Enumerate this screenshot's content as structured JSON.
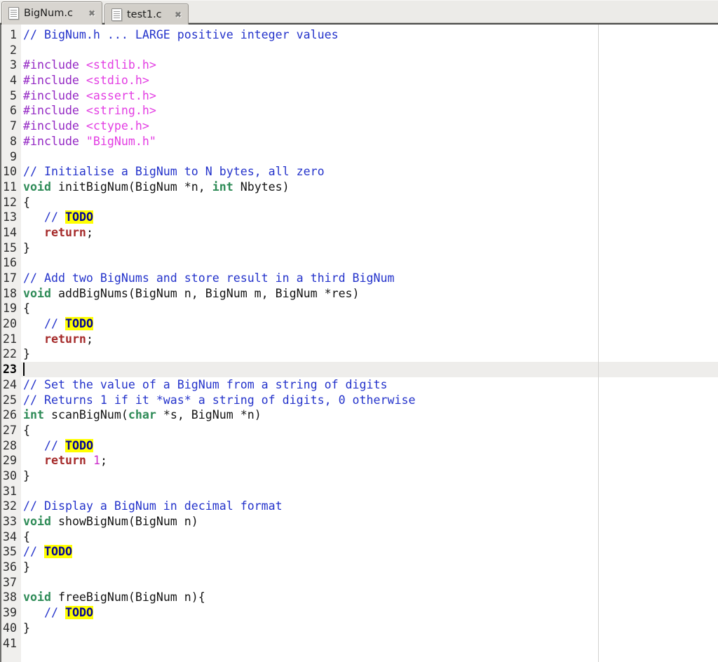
{
  "tabs": [
    {
      "label": "BigNum.c",
      "active": true
    },
    {
      "label": "test1.c",
      "active": false
    }
  ],
  "icons": {
    "close": "✖",
    "document": "document-icon"
  },
  "colors": {
    "comment": "#2433cb",
    "preprocessor": "#9428c4",
    "include_string": "#e33ee3",
    "type_keyword": "#2e8b57",
    "flow_keyword": "#a52a2a",
    "number": "#cb2dcb",
    "todo_fg": "#000099",
    "todo_bg": "#ffff00",
    "current_line_bg": "#eeedeb",
    "margin_line": "#d2d1cf",
    "gutter_bg": "#f0efed",
    "tabbar_bg": "#ecebe8"
  },
  "editor": {
    "current_line": 23,
    "lines": [
      {
        "n": 1,
        "segs": [
          [
            "comment",
            "// BigNum.h ... LARGE positive integer values"
          ]
        ]
      },
      {
        "n": 2,
        "segs": []
      },
      {
        "n": 3,
        "segs": [
          [
            "preproc",
            "#include "
          ],
          [
            "incstr",
            "<stdlib.h>"
          ]
        ]
      },
      {
        "n": 4,
        "segs": [
          [
            "preproc",
            "#include "
          ],
          [
            "incstr",
            "<stdio.h>"
          ]
        ]
      },
      {
        "n": 5,
        "segs": [
          [
            "preproc",
            "#include "
          ],
          [
            "incstr",
            "<assert.h>"
          ]
        ]
      },
      {
        "n": 6,
        "segs": [
          [
            "preproc",
            "#include "
          ],
          [
            "incstr",
            "<string.h>"
          ]
        ]
      },
      {
        "n": 7,
        "segs": [
          [
            "preproc",
            "#include "
          ],
          [
            "incstr",
            "<ctype.h>"
          ]
        ]
      },
      {
        "n": 8,
        "segs": [
          [
            "preproc",
            "#include "
          ],
          [
            "incstr",
            "\"BigNum.h\""
          ]
        ]
      },
      {
        "n": 9,
        "segs": []
      },
      {
        "n": 10,
        "segs": [
          [
            "comment",
            "// Initialise a BigNum to N bytes, all zero"
          ]
        ]
      },
      {
        "n": 11,
        "segs": [
          [
            "type",
            "void"
          ],
          [
            "plain",
            " initBigNum(BigNum *n, "
          ],
          [
            "type",
            "int"
          ],
          [
            "plain",
            " Nbytes)"
          ]
        ]
      },
      {
        "n": 12,
        "segs": [
          [
            "plain",
            "{"
          ]
        ]
      },
      {
        "n": 13,
        "segs": [
          [
            "plain",
            "   "
          ],
          [
            "comment",
            "// "
          ],
          [
            "todo",
            "TODO"
          ]
        ]
      },
      {
        "n": 14,
        "segs": [
          [
            "plain",
            "   "
          ],
          [
            "kw",
            "return"
          ],
          [
            "plain",
            ";"
          ]
        ]
      },
      {
        "n": 15,
        "segs": [
          [
            "plain",
            "}"
          ]
        ]
      },
      {
        "n": 16,
        "segs": []
      },
      {
        "n": 17,
        "segs": [
          [
            "comment",
            "// Add two BigNums and store result in a third BigNum"
          ]
        ]
      },
      {
        "n": 18,
        "segs": [
          [
            "type",
            "void"
          ],
          [
            "plain",
            " addBigNums(BigNum n, BigNum m, BigNum *res)"
          ]
        ]
      },
      {
        "n": 19,
        "segs": [
          [
            "plain",
            "{"
          ]
        ]
      },
      {
        "n": 20,
        "segs": [
          [
            "plain",
            "   "
          ],
          [
            "comment",
            "// "
          ],
          [
            "todo",
            "TODO"
          ]
        ]
      },
      {
        "n": 21,
        "segs": [
          [
            "plain",
            "   "
          ],
          [
            "kw",
            "return"
          ],
          [
            "plain",
            ";"
          ]
        ]
      },
      {
        "n": 22,
        "segs": [
          [
            "plain",
            "}"
          ]
        ]
      },
      {
        "n": 23,
        "segs": [],
        "current": true,
        "cursor": true
      },
      {
        "n": 24,
        "segs": [
          [
            "comment",
            "// Set the value of a BigNum from a string of digits"
          ]
        ]
      },
      {
        "n": 25,
        "segs": [
          [
            "comment",
            "// Returns 1 if it *was* a string of digits, 0 otherwise"
          ]
        ]
      },
      {
        "n": 26,
        "segs": [
          [
            "type",
            "int"
          ],
          [
            "plain",
            " scanBigNum("
          ],
          [
            "type",
            "char"
          ],
          [
            "plain",
            " *s, BigNum *n)"
          ]
        ]
      },
      {
        "n": 27,
        "segs": [
          [
            "plain",
            "{"
          ]
        ]
      },
      {
        "n": 28,
        "segs": [
          [
            "plain",
            "   "
          ],
          [
            "comment",
            "// "
          ],
          [
            "todo",
            "TODO"
          ]
        ]
      },
      {
        "n": 29,
        "segs": [
          [
            "plain",
            "   "
          ],
          [
            "kw",
            "return"
          ],
          [
            "plain",
            " "
          ],
          [
            "num",
            "1"
          ],
          [
            "plain",
            ";"
          ]
        ]
      },
      {
        "n": 30,
        "segs": [
          [
            "plain",
            "}"
          ]
        ]
      },
      {
        "n": 31,
        "segs": []
      },
      {
        "n": 32,
        "segs": [
          [
            "comment",
            "// Display a BigNum in decimal format"
          ]
        ]
      },
      {
        "n": 33,
        "segs": [
          [
            "type",
            "void"
          ],
          [
            "plain",
            " showBigNum(BigNum n)"
          ]
        ]
      },
      {
        "n": 34,
        "segs": [
          [
            "plain",
            "{"
          ]
        ]
      },
      {
        "n": 35,
        "segs": [
          [
            "comment",
            "// "
          ],
          [
            "todo",
            "TODO"
          ]
        ]
      },
      {
        "n": 36,
        "segs": [
          [
            "plain",
            "}"
          ]
        ]
      },
      {
        "n": 37,
        "segs": []
      },
      {
        "n": 38,
        "segs": [
          [
            "type",
            "void"
          ],
          [
            "plain",
            " freeBigNum(BigNum n){"
          ]
        ]
      },
      {
        "n": 39,
        "segs": [
          [
            "plain",
            "   "
          ],
          [
            "comment",
            "// "
          ],
          [
            "todo",
            "TODO"
          ]
        ]
      },
      {
        "n": 40,
        "segs": [
          [
            "plain",
            "}"
          ]
        ]
      },
      {
        "n": 41,
        "segs": []
      }
    ]
  }
}
